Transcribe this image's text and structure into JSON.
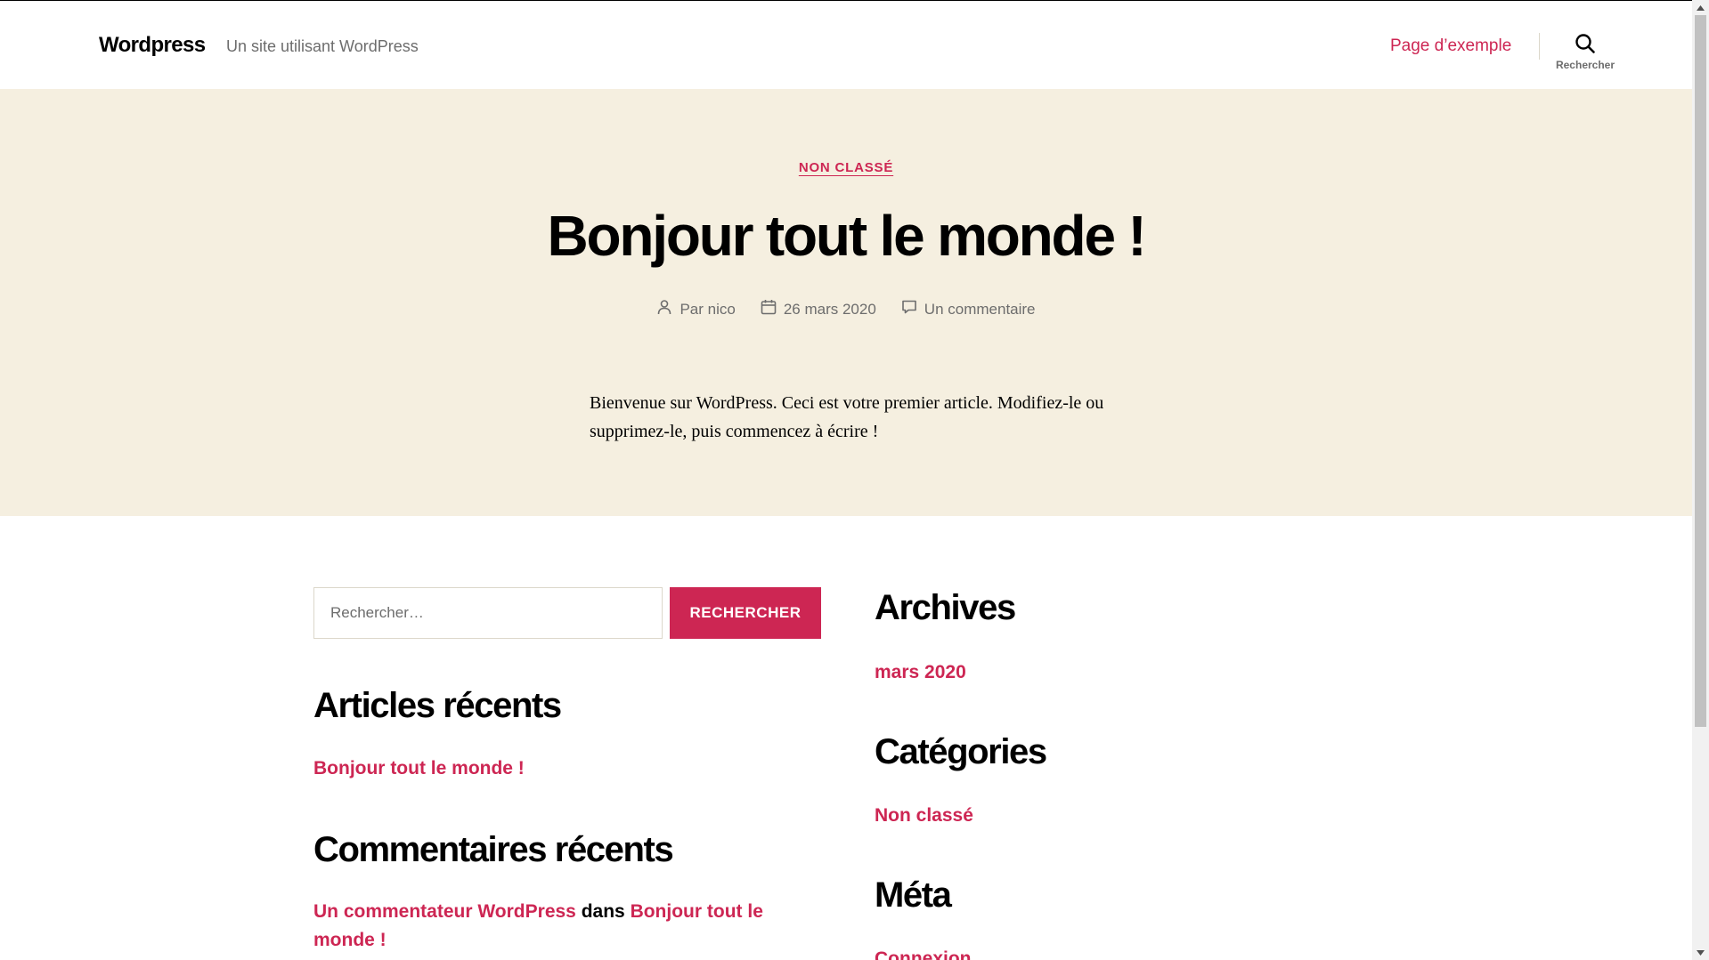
{
  "header": {
    "site_title": "Wordpress",
    "site_description": "Un site utilisant WordPress",
    "nav_link": "Page d’exemple",
    "search_label": "Rechercher"
  },
  "hero": {
    "category": "NON CLASSÉ",
    "title": "Bonjour tout le monde !",
    "author": "Par nico",
    "date": "26 mars 2020",
    "comments": "Un commentaire",
    "excerpt": "Bienvenue sur WordPress. Ceci est votre premier article. Modifiez-le ou supprimez-le, puis commencez à écrire !"
  },
  "widgets": {
    "search": {
      "placeholder": "Rechercher…",
      "button": "RECHERCHER"
    },
    "recent_posts": {
      "title": "Articles récents",
      "items": [
        "Bonjour tout le monde !"
      ]
    },
    "recent_comments": {
      "title": "Commentaires récents",
      "author": "Un commentateur WordPress",
      "connector": "dans",
      "post": "Bonjour tout le monde !"
    },
    "archives": {
      "title": "Archives",
      "items": [
        "mars 2020"
      ]
    },
    "categories": {
      "title": "Catégories",
      "items": [
        "Non classé"
      ]
    },
    "meta": {
      "title": "Méta",
      "items": [
        "Connexion"
      ]
    }
  },
  "colors": {
    "accent": "#cd2653",
    "hero_bg": "#f5efe0",
    "secondary_text": "#6d6d6d",
    "border": "#dcd7ca"
  },
  "icons": {
    "search": "search-icon",
    "author": "user-icon",
    "date": "calendar-icon",
    "comment": "comment-icon"
  }
}
